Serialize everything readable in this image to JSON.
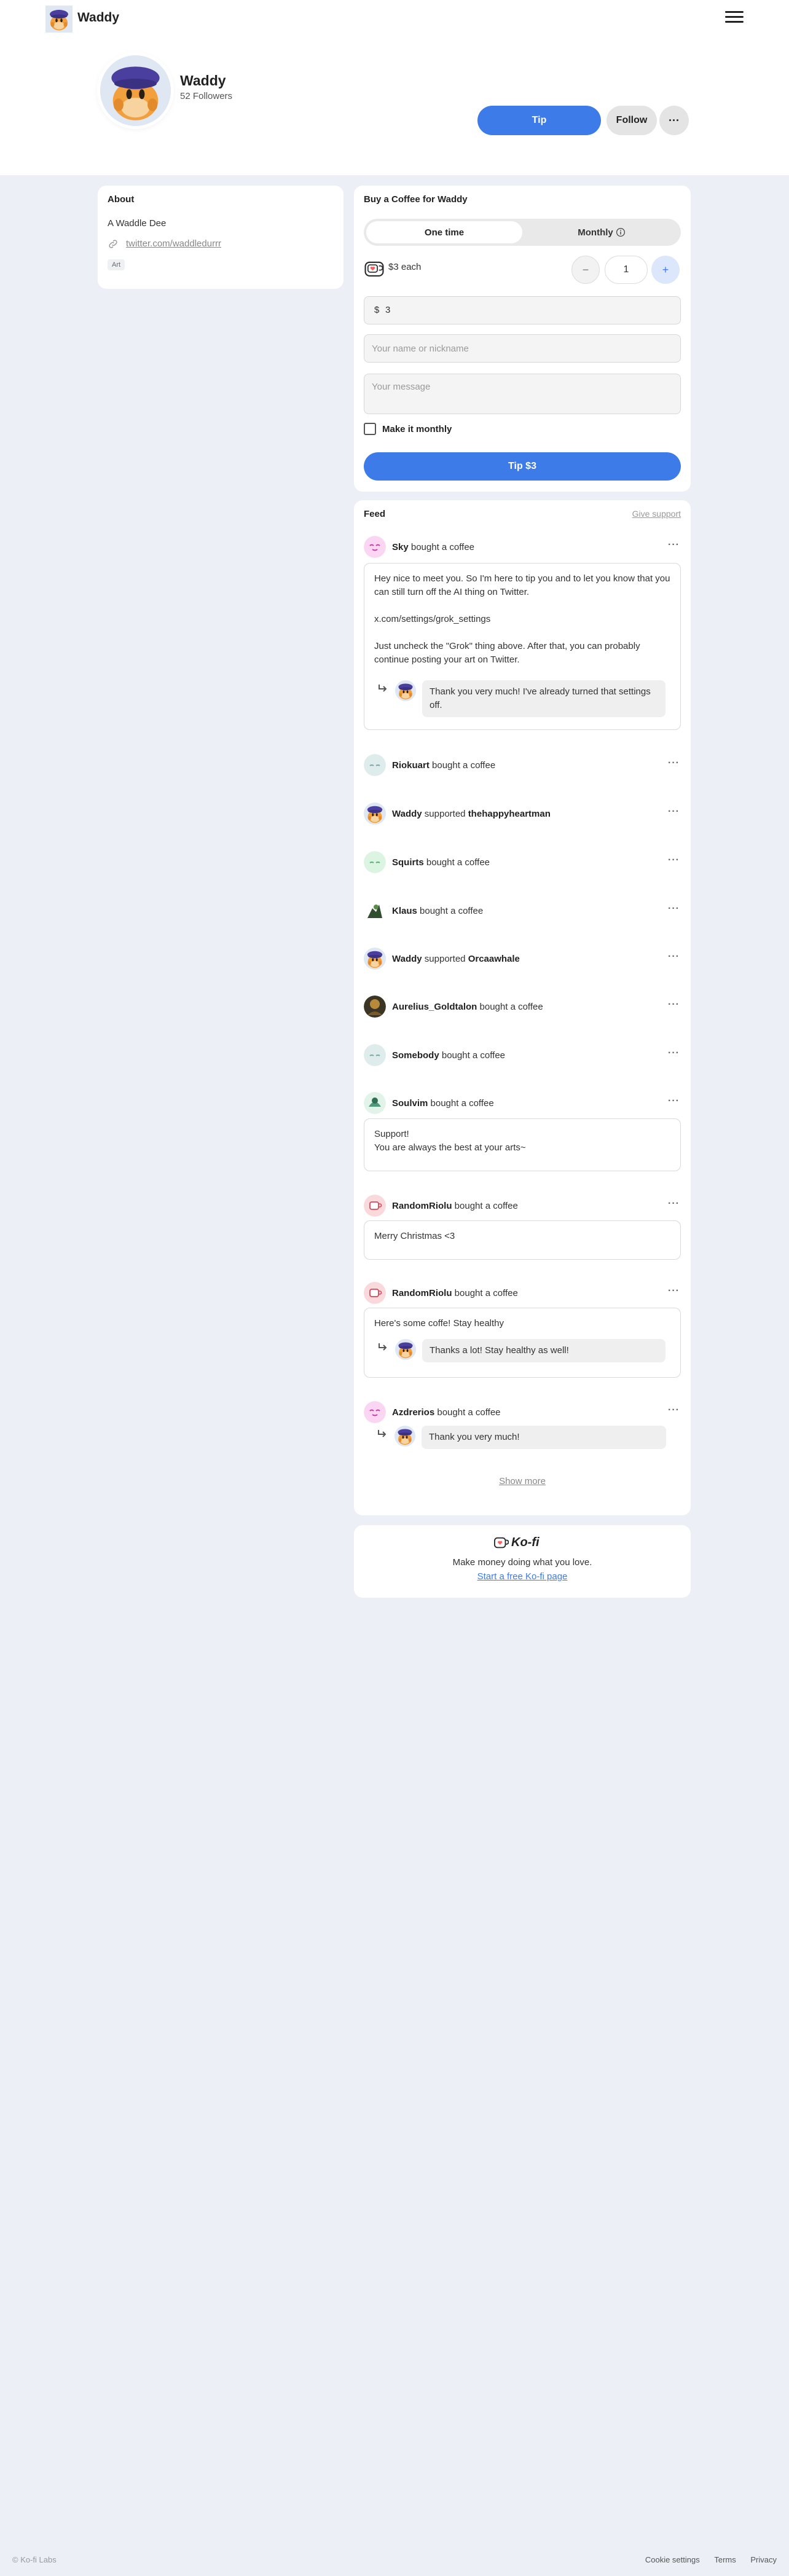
{
  "nav": {
    "name": "Waddy"
  },
  "profile": {
    "name": "Waddy",
    "followers": "52 Followers",
    "tip_label": "Tip",
    "follow_label": "Follow",
    "more_label": "···"
  },
  "about": {
    "title": "About",
    "description": "A Waddle Dee",
    "link": "twitter.com/waddledurrr",
    "tag": "Art"
  },
  "buy": {
    "title": "Buy a Coffee for Waddy",
    "one_time": "One time",
    "monthly": "Monthly",
    "each": "$3 each",
    "qty_minus": "−",
    "quantity": "1",
    "qty_plus": "+",
    "currency": "$",
    "amount": "3",
    "name_placeholder": "Your name or nickname",
    "message_placeholder": "Your message",
    "make_monthly": "Make it monthly",
    "submit": "Tip $3"
  },
  "feed": {
    "title": "Feed",
    "give_support": "Give support",
    "dots": "···",
    "items": [
      {
        "name": "Sky",
        "action": "bought a coffee"
      },
      {
        "name": "Riokuart",
        "action": "bought a coffee"
      },
      {
        "name": "Waddy",
        "action": "supported",
        "target": "thehappyheartman"
      },
      {
        "name": "Squirts",
        "action": "bought a coffee"
      },
      {
        "name": "Klaus",
        "action": "bought a coffee"
      },
      {
        "name": "Waddy",
        "action": "supported",
        "target": "Orcaawhale"
      },
      {
        "name": "Aurelius_Goldtalon",
        "action": "bought a coffee"
      },
      {
        "name": "Somebody",
        "action": "bought a coffee"
      },
      {
        "name": "Soulvim",
        "action": "bought a coffee"
      },
      {
        "name": "RandomRiolu",
        "action": "bought a coffee"
      },
      {
        "name": "RandomRiolu",
        "action": "bought a coffee"
      },
      {
        "name": "Azdrerios",
        "action": "bought a coffee"
      }
    ],
    "messages": {
      "sky_p1": "Hey nice to meet you. So I'm here to tip you and to let you know that you can still turn off the AI thing on Twitter.",
      "sky_p2": "x.com/settings/grok_settings",
      "sky_p3": "Just uncheck the \"Grok\" thing above. After that, you can probably continue posting your art on Twitter.",
      "sky_reply": "Thank you very much! I've already turned that settings off.",
      "soulvim_l1": "Support!",
      "soulvim_l2": "You are always the best at your arts~",
      "riolu1": "Merry Christmas <3",
      "riolu2": "Here's some coffe! Stay healthy",
      "riolu2_reply": "Thanks a lot! Stay healthy as well!",
      "azdrerios_reply": "Thank you very much!"
    },
    "show_more": "Show more"
  },
  "kofi": {
    "logo": "Ko-fi",
    "tagline": "Make money doing what you love.",
    "link": "Start a free Ko-fi page"
  },
  "footer": {
    "copyright": "© Ko-fi Labs",
    "cookie": "Cookie settings",
    "terms": "Terms",
    "privacy": "Privacy"
  },
  "colors": {
    "accent": "#3d7be8",
    "page_bg": "#eceff6"
  }
}
